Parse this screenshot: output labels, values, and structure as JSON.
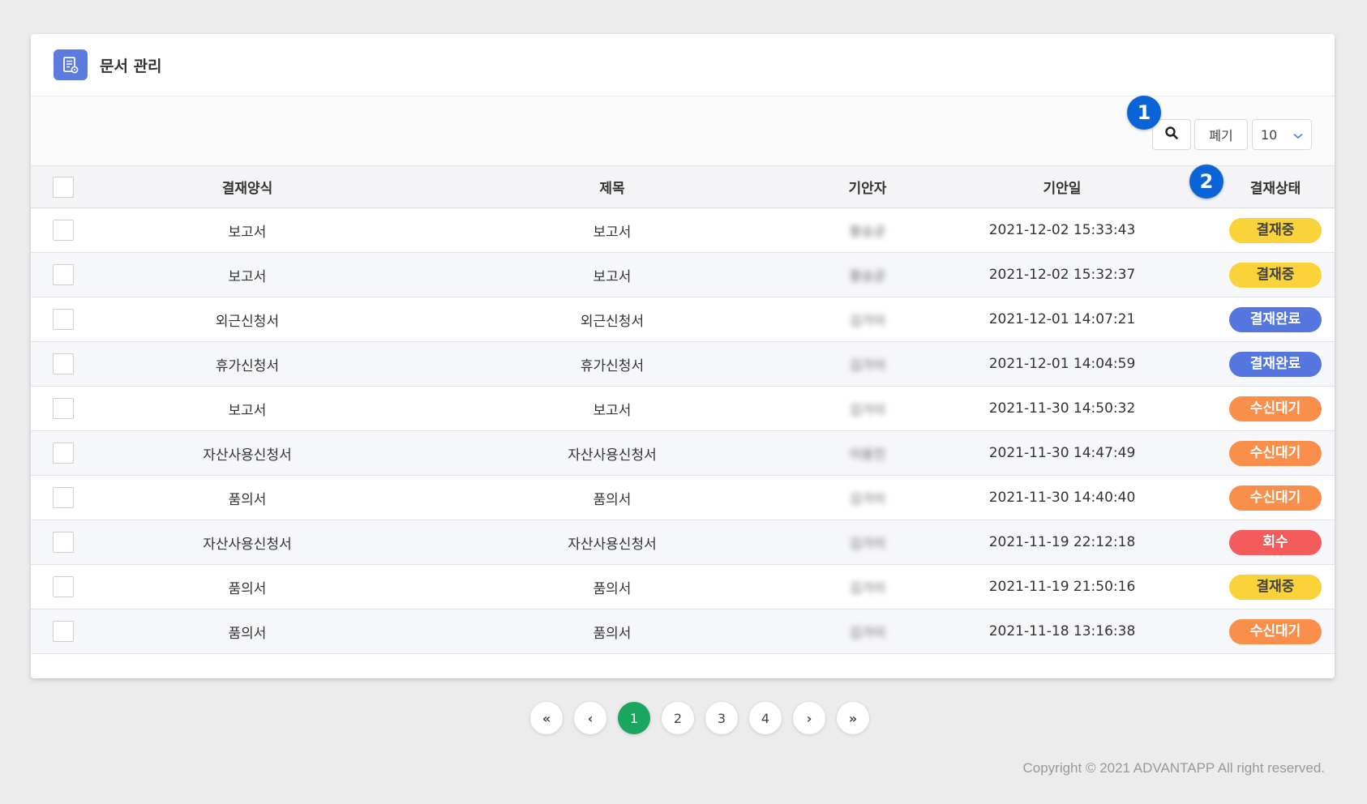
{
  "header": {
    "title": "문서 관리",
    "icon": "document-icon"
  },
  "toolbar": {
    "search_icon": "search-icon",
    "discard_label": "폐기",
    "page_size": "10"
  },
  "callouts": {
    "one": "1",
    "two": "2"
  },
  "table": {
    "columns": [
      "결재양식",
      "제목",
      "기안자",
      "기안일",
      "결재상태"
    ],
    "rows": [
      {
        "form": "보고서",
        "title": "보고서",
        "drafter": "황승균",
        "date": "2021-12-02 15:33:43",
        "status": "결재중",
        "status_color": "#fad33a"
      },
      {
        "form": "보고서",
        "title": "보고서",
        "drafter": "황승균",
        "date": "2021-12-02 15:32:37",
        "status": "결재중",
        "status_color": "#fad33a"
      },
      {
        "form": "외근신청서",
        "title": "외근신청서",
        "drafter": "김가이",
        "date": "2021-12-01 14:07:21",
        "status": "결재완료",
        "status_color": "#5576de"
      },
      {
        "form": "휴가신청서",
        "title": "휴가신청서",
        "drafter": "김가이",
        "date": "2021-12-01 14:04:59",
        "status": "결재완료",
        "status_color": "#5576de"
      },
      {
        "form": "보고서",
        "title": "보고서",
        "drafter": "김가이",
        "date": "2021-11-30 14:50:32",
        "status": "수신대기",
        "status_color": "#f98f4a"
      },
      {
        "form": "자산사용신청서",
        "title": "자산사용신청서",
        "drafter": "이용진",
        "date": "2021-11-30 14:47:49",
        "status": "수신대기",
        "status_color": "#f98f4a"
      },
      {
        "form": "품의서",
        "title": "품의서",
        "drafter": "김가이",
        "date": "2021-11-30 14:40:40",
        "status": "수신대기",
        "status_color": "#f98f4a"
      },
      {
        "form": "자산사용신청서",
        "title": "자산사용신청서",
        "drafter": "김가이",
        "date": "2021-11-19 22:12:18",
        "status": "회수",
        "status_color": "#f45c5c"
      },
      {
        "form": "품의서",
        "title": "품의서",
        "drafter": "김가이",
        "date": "2021-11-19 21:50:16",
        "status": "결재중",
        "status_color": "#fad33a"
      },
      {
        "form": "품의서",
        "title": "품의서",
        "drafter": "김가이",
        "date": "2021-11-18 13:16:38",
        "status": "수신대기",
        "status_color": "#f98f4a"
      }
    ]
  },
  "pagination": {
    "first": "«",
    "prev": "‹",
    "next": "›",
    "last": "»",
    "pages": [
      "1",
      "2",
      "3",
      "4"
    ],
    "current": "1"
  },
  "footer": {
    "copyright": "Copyright © 2021 ADVANTAPP All right reserved."
  }
}
